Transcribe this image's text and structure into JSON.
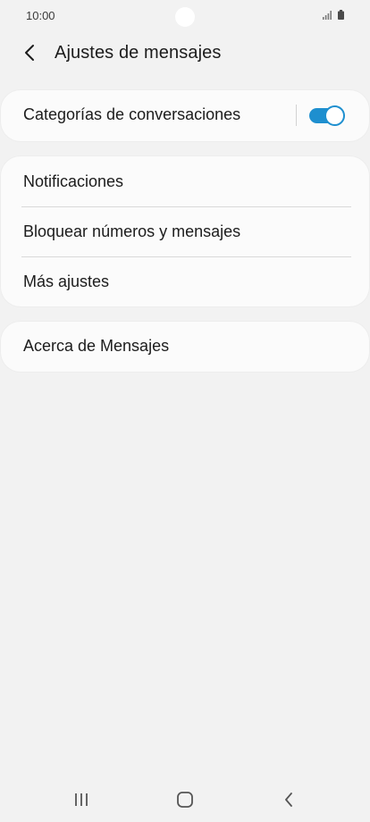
{
  "status_bar": {
    "time": "10:00",
    "signal_icon": "signal-icon",
    "battery_icon": "battery-icon"
  },
  "header": {
    "back_icon": "chevron-left-icon",
    "title": "Ajustes de mensajes"
  },
  "sections": {
    "conversation_categories": {
      "label": "Categorías de conversaciones",
      "toggle_on": true
    },
    "items": [
      {
        "label": "Notificaciones"
      },
      {
        "label": "Bloquear números y mensajes"
      },
      {
        "label": "Más ajustes"
      }
    ],
    "about": {
      "label": "Acerca de Mensajes"
    }
  },
  "nav_bar": {
    "recents_icon": "recent-apps-icon",
    "home_icon": "home-icon",
    "back_icon": "back-icon"
  },
  "colors": {
    "accent": "#1e8fcf",
    "background": "#f2f2f2",
    "card": "#fbfbfb"
  }
}
